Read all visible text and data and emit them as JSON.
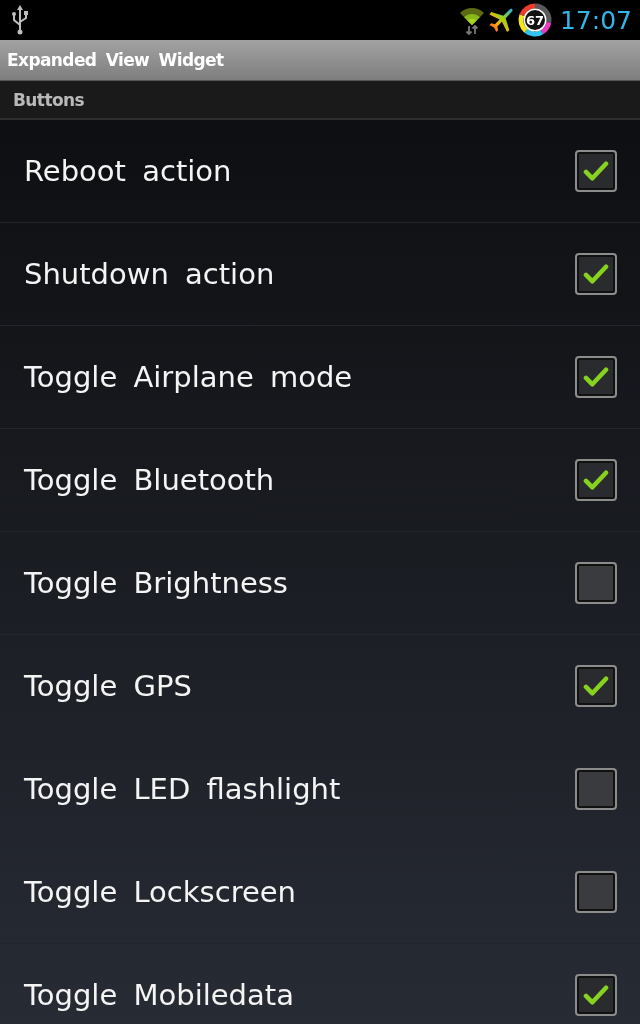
{
  "status_bar": {
    "battery": "67",
    "time": "17:07"
  },
  "title_bar": {
    "title": "Expanded View Widget"
  },
  "section": {
    "title": "Buttons"
  },
  "items": [
    {
      "label": "Reboot action",
      "checked": true
    },
    {
      "label": "Shutdown action",
      "checked": true
    },
    {
      "label": "Toggle Airplane mode",
      "checked": true
    },
    {
      "label": "Toggle Bluetooth",
      "checked": true
    },
    {
      "label": "Toggle Brightness",
      "checked": false
    },
    {
      "label": "Toggle GPS",
      "checked": true
    },
    {
      "label": "Toggle LED flashlight",
      "checked": false
    },
    {
      "label": "Toggle Lockscreen",
      "checked": false
    },
    {
      "label": "Toggle Mobiledata",
      "checked": true
    }
  ]
}
